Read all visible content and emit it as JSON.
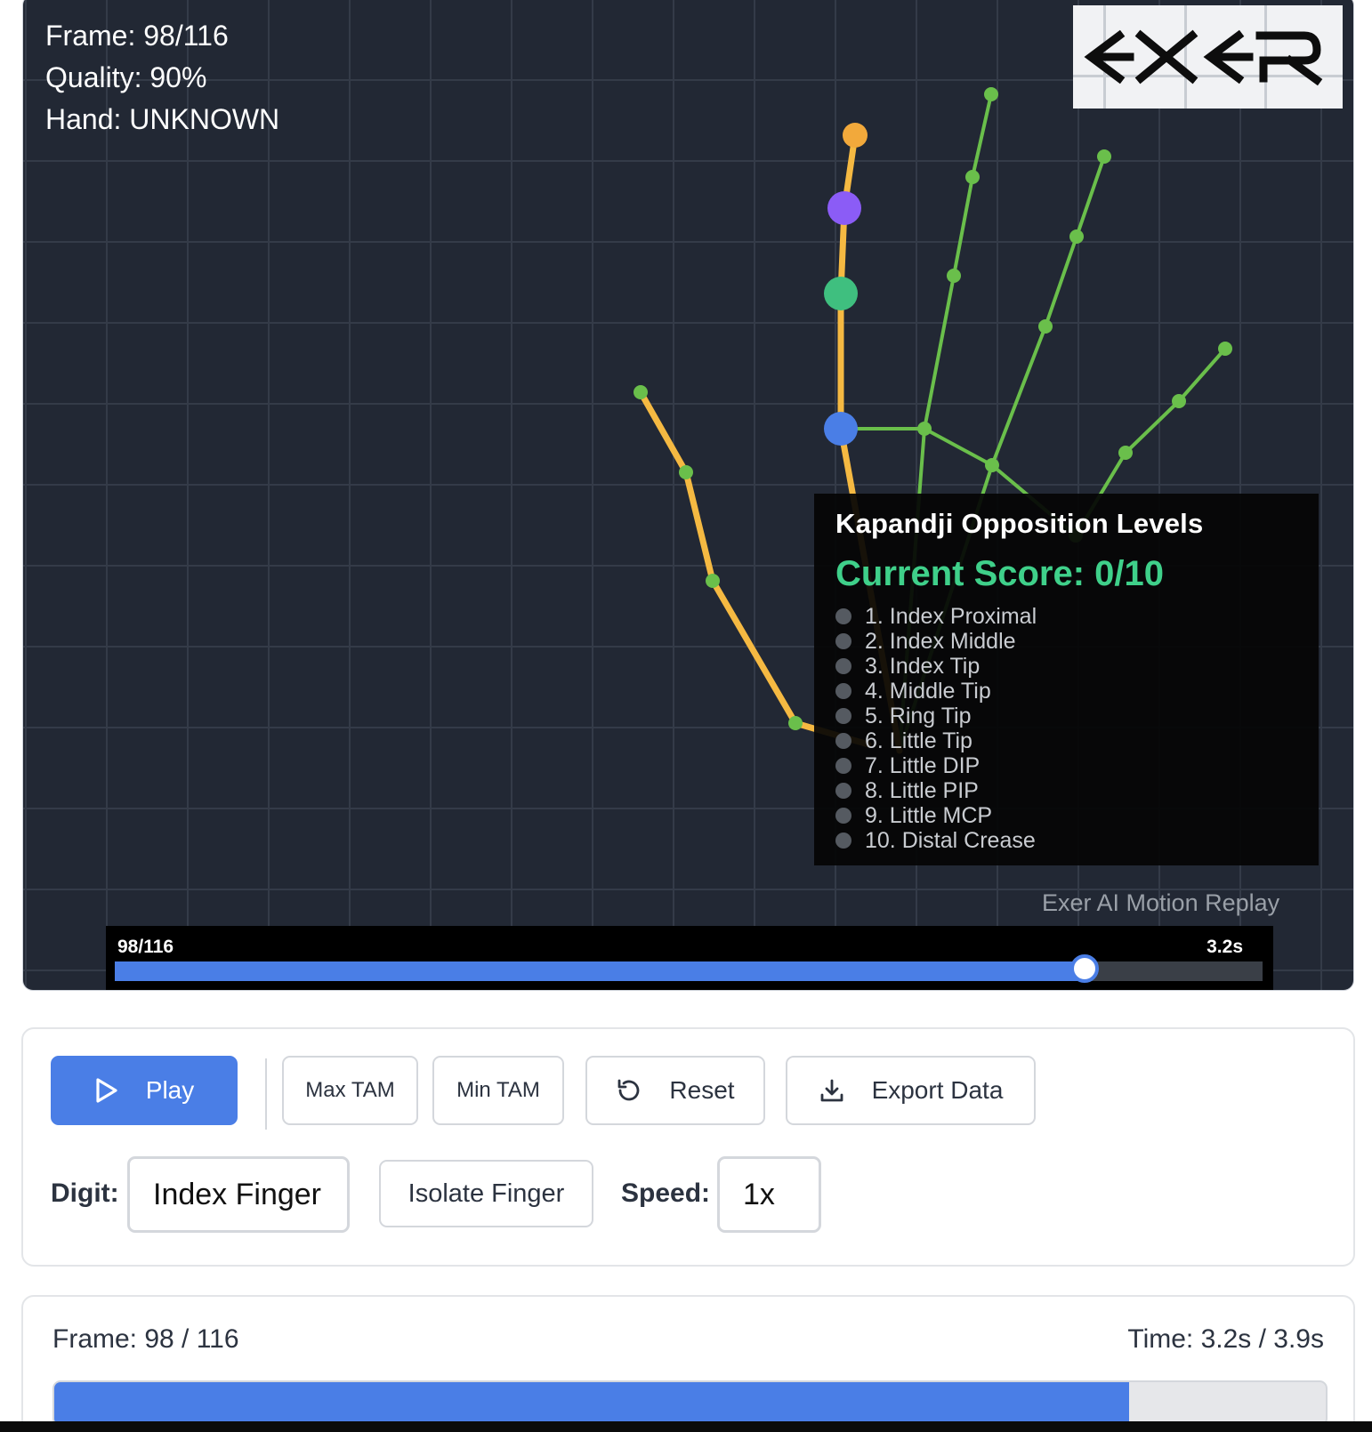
{
  "hud": {
    "frame": "Frame: 98/116",
    "quality": "Quality: 90%",
    "hand": "Hand: UNKNOWN"
  },
  "logo": {
    "text": "EXER",
    "icon": "exer-logo"
  },
  "kapandji": {
    "title": "Kapandji Opposition Levels",
    "score": "Current Score: 0/10",
    "levels": [
      "1. Index Proximal",
      "2. Index Middle",
      "3. Index Tip",
      "4. Middle Tip",
      "5. Ring Tip",
      "6. Little Tip",
      "7. Little DIP",
      "8. Little PIP",
      "9. Little MCP",
      "10. Distal Crease"
    ]
  },
  "watermark": "Exer AI Motion Replay",
  "scrubber": {
    "left_label": "98/116",
    "right_label": "3.2s",
    "progress": 0.845
  },
  "controls": {
    "play": {
      "label": "Play",
      "icon": "play-icon"
    },
    "max_tam": "Max TAM",
    "min_tam": "Min TAM",
    "reset": {
      "label": "Reset",
      "icon": "reset-icon"
    },
    "export": {
      "label": "Export Data",
      "icon": "download-icon"
    },
    "digit_label": "Digit:",
    "digit_value": "Index Finger",
    "isolate": "Isolate Finger",
    "speed_label": "Speed:",
    "speed_value": "1x"
  },
  "progress": {
    "frame_text": "Frame: 98 / 116",
    "time_text": "Time: 3.2s / 3.9s",
    "fraction": 0.845
  },
  "colors": {
    "accent": "#4a7ee6",
    "score_green": "#3fd08a",
    "skeleton_green": "#6abf4b",
    "highlight_orange": "#f5b942",
    "canvas_bg": "#222834"
  }
}
